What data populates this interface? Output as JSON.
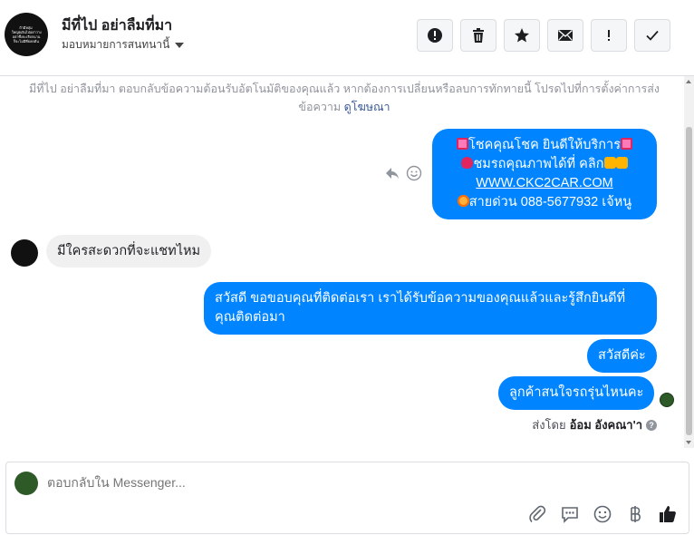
{
  "header": {
    "avatar_lines": [
      "ถ้ามีหลุ่ม",
      "ใหญ่ตเงินไป่อย่าว่าง",
      "อย่าซึ่งจะเรียกนาน",
      "ก็จะไม่มีที่ยลดต้น"
    ],
    "title": "มีที่ไป อย่าลืมที่มา",
    "assign_label": "มอบหมายการสนทนานี้",
    "toolbar": [
      {
        "name": "report-spam-button",
        "icon": "alert-circle-icon"
      },
      {
        "name": "delete-button",
        "icon": "trash-icon"
      },
      {
        "name": "star-button",
        "icon": "star-icon"
      },
      {
        "name": "mark-unread-button",
        "icon": "envelope-icon"
      },
      {
        "name": "follow-up-button",
        "icon": "exclamation-icon"
      },
      {
        "name": "done-button",
        "icon": "check-icon"
      }
    ]
  },
  "notice": {
    "text": "มีที่ไป อย่าลืมที่มา ตอบกลับข้อความต้อนรับอัตโนมัติของคุณแล้ว หากต้องการเปลี่ยนหรือลบการทักทายนี้ โปรดไปที่การตั้งค่าการส่งข้อความ",
    "link": "ดูโฆษณา"
  },
  "messages": {
    "promo_line1": "โชคคุณโชค ยินดีให้บริการ",
    "promo_line2": "ชมรถคุณภาพได้ที่    คลิก",
    "promo_link": "WWW.CKC2CAR.COM",
    "promo_line4": "สายด่วน 088-5677932 เจ้หนู",
    "incoming": "มีใครสะดวกที่จะแชทไหม",
    "reply1": "สวัสดี ขอขอบคุณที่ติดต่อเรา เราได้รับข้อความของคุณแล้วและรู้สึกยินดีที่คุณติดต่อมา",
    "reply2": "สวัสดีค่ะ",
    "reply3": "ลูกค้าสนใจรถรุ่นไหนคะ"
  },
  "sent_by": {
    "prefix": "ส่งโดย",
    "name": "อ้อม อังคณา'า"
  },
  "composer": {
    "placeholder": "ตอบกลับใน Messenger..."
  },
  "colors": {
    "outgoing_bubble": "#0084ff",
    "incoming_bubble": "#f1f0f0",
    "link": "#385898"
  }
}
